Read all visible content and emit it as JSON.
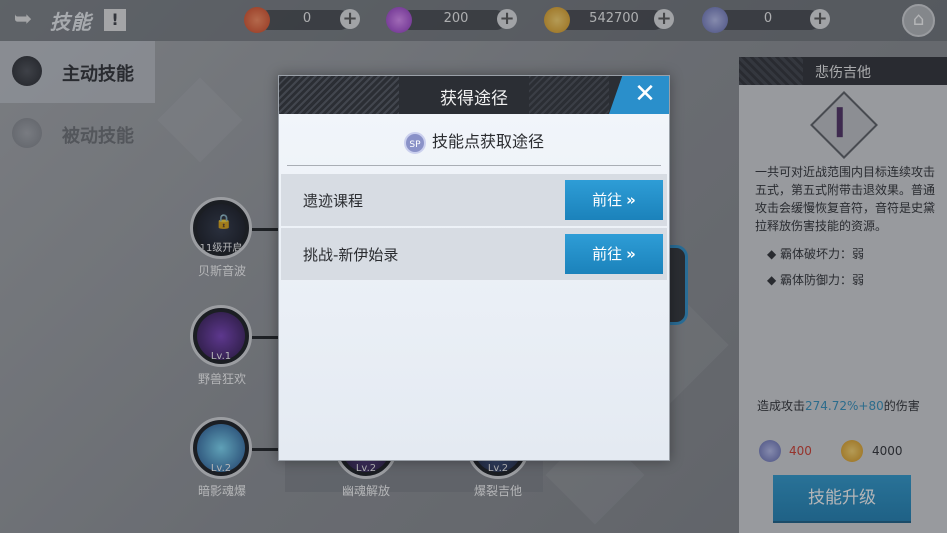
{
  "topbar": {
    "title": "技能",
    "info_label": "!",
    "resources": [
      {
        "icon": "red-gem-icon",
        "value": "0",
        "color": "#e8552d"
      },
      {
        "icon": "purple-crystal-icon",
        "value": "200",
        "color": "#a23fd0"
      },
      {
        "icon": "gold-coin-icon",
        "value": "542700",
        "color": "#e6a21c"
      },
      {
        "icon": "sp-point-icon",
        "value": "0",
        "color": "#7b83c4"
      }
    ]
  },
  "tabs": [
    {
      "label": "主动技能",
      "active": true
    },
    {
      "label": "被动技能",
      "active": false
    }
  ],
  "skills": [
    {
      "name": "贝斯音波",
      "level": "11级开启",
      "locked": true
    },
    {
      "name": "野兽狂欢",
      "level": "Lv.1",
      "locked": false
    },
    {
      "name": "暗影魂爆",
      "level": "Lv.2",
      "locked": false
    },
    {
      "name": "幽魂解放",
      "level": "Lv.2",
      "locked": false
    },
    {
      "name": "爆裂吉他",
      "level": "Lv.2",
      "locked": false
    }
  ],
  "detail": {
    "title": "悲伤吉他",
    "description": "一共可对近战范围内目标连续攻击五式，第五式附带击退效果。普通攻击会缓慢恢复音符，音符是史黛拉释放伤害技能的资源。",
    "stats": [
      "◆ 霸体破坏力：弱",
      "◆ 霸体防御力：弱"
    ],
    "damage_prefix": "造成攻击",
    "damage_value": "274.72%+80",
    "damage_suffix": "的伤害",
    "cost_sp": "400",
    "cost_gold": "4000",
    "upgrade_label": "技能升级"
  },
  "modal": {
    "title": "获得途径",
    "close_label": "✕",
    "section_icon_text": "SP",
    "section_title": "技能点获取途径",
    "rows": [
      {
        "label": "遗迹课程",
        "button": "前往"
      },
      {
        "label": "挑战-新伊始录",
        "button": "前往"
      }
    ]
  }
}
